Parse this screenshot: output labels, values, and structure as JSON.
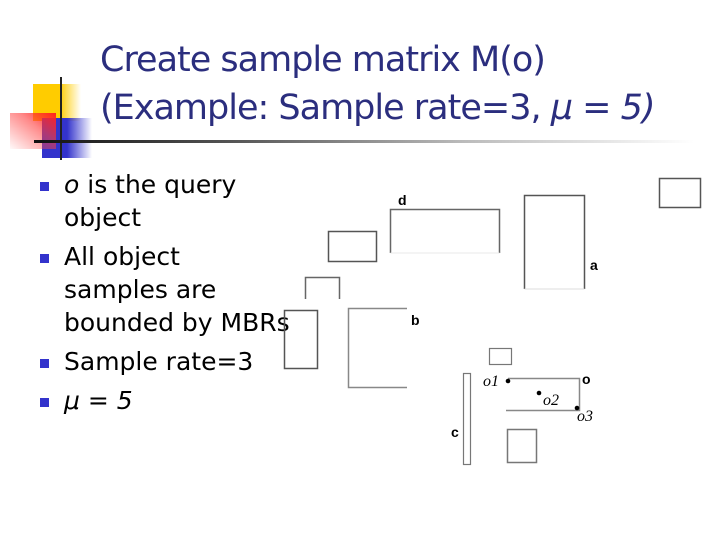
{
  "title": {
    "line1": "Create sample matrix M(o)",
    "line2_prefix": "(Example: Sample rate=3, ",
    "line2_mu": "μ = 5)"
  },
  "bullets": [
    {
      "italic_prefix": "o",
      "text": " is the query object"
    },
    {
      "italic_prefix": "",
      "text": "All object samples are bounded by MBRs"
    },
    {
      "italic_prefix": "",
      "text": "Sample rate=3"
    },
    {
      "italic_prefix": "μ = 5",
      "text": ""
    }
  ],
  "diagram": {
    "labels": {
      "d": "d",
      "a": "a",
      "b": "b",
      "c": "c",
      "o": "o",
      "o1": "o1",
      "o2": "o2",
      "o3": "o3"
    }
  },
  "colors": {
    "title": "#2b2e7e",
    "bullet_marker": "#3333cc",
    "deco_yellow": "#ffcc00",
    "deco_red": "#ff2020",
    "deco_blue": "#3333cc"
  }
}
